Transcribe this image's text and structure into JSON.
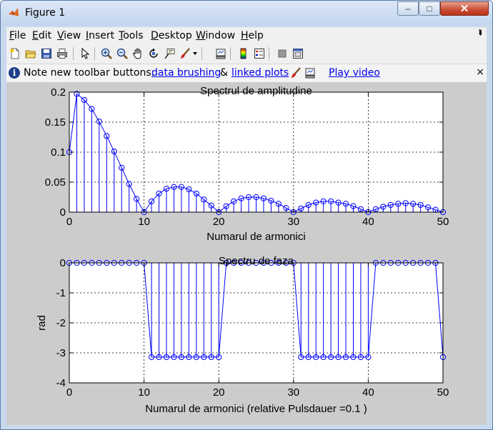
{
  "window": {
    "title": "Figure 1",
    "controls": {
      "minimize": "–",
      "maximize": "□",
      "close": "✕"
    }
  },
  "menu": {
    "items": [
      "File",
      "Edit",
      "View",
      "Insert",
      "Tools",
      "Desktop",
      "Window",
      "Help"
    ],
    "overflow_icon": "chevron-icon"
  },
  "toolbar": {
    "buttons": [
      "new-figure-icon",
      "open-file-icon",
      "save-icon",
      "print-icon",
      "edit-plot-icon",
      "zoom-in-icon",
      "zoom-out-icon",
      "pan-icon",
      "rotate-3d-icon",
      "data-cursor-icon",
      "brush-icon",
      "brush-dropdown-icon",
      "link-plot-icon",
      "insert-colorbar-icon",
      "insert-legend-icon",
      "hide-plot-tools-icon",
      "show-plot-tools-icon"
    ]
  },
  "notification": {
    "text_before": "Note new toolbar buttons:",
    "link_brushing": "data brushing",
    "amp": "&",
    "link_linked": "linked plots",
    "link_video": "Play video",
    "close": "×"
  },
  "chart_data": [
    {
      "type": "stem",
      "title": "Spectrul de amplitudine",
      "xlabel": "Numarul de armonici",
      "ylabel": "",
      "xlim": [
        0,
        50
      ],
      "ylim": [
        0,
        0.2
      ],
      "xticks": [
        0,
        10,
        20,
        30,
        40,
        50
      ],
      "yticks": [
        0,
        0.05,
        0.1,
        0.15,
        0.2
      ],
      "ytick_labels": [
        "0",
        "0.05",
        "0.1",
        "0.15",
        "0.2"
      ],
      "grid": true,
      "color": "#0000ff",
      "marker": "circle",
      "connected_line": true,
      "x": [
        0,
        1,
        2,
        3,
        4,
        5,
        6,
        7,
        8,
        9,
        10,
        11,
        12,
        13,
        14,
        15,
        16,
        17,
        18,
        19,
        20,
        21,
        22,
        23,
        24,
        25,
        26,
        27,
        28,
        29,
        30,
        31,
        32,
        33,
        34,
        35,
        36,
        37,
        38,
        39,
        40,
        41,
        42,
        43,
        44,
        45,
        46,
        47,
        48,
        49,
        50
      ],
      "y": [
        0.1,
        0.197,
        0.187,
        0.172,
        0.151,
        0.127,
        0.101,
        0.074,
        0.047,
        0.022,
        0,
        0.018,
        0.031,
        0.039,
        0.042,
        0.042,
        0.038,
        0.031,
        0.021,
        0.011,
        0,
        0.01,
        0.018,
        0.023,
        0.025,
        0.025,
        0.023,
        0.019,
        0.014,
        0.007,
        0,
        0.006,
        0.012,
        0.016,
        0.018,
        0.018,
        0.016,
        0.014,
        0.01,
        0.005,
        0,
        0.005,
        0.009,
        0.012,
        0.014,
        0.015,
        0.014,
        0.012,
        0.008,
        0.004,
        0
      ]
    },
    {
      "type": "stem",
      "title": "Spectru de faza",
      "xlabel": "Numarul de armonici (relative Pulsdauer =0.1 )",
      "ylabel": "rad",
      "xlim": [
        0,
        50
      ],
      "ylim": [
        -4,
        0
      ],
      "xticks": [
        0,
        10,
        20,
        30,
        40,
        50
      ],
      "yticks": [
        -4,
        -3,
        -2,
        -1,
        0
      ],
      "ytick_labels": [
        "-4",
        "-3",
        "-2",
        "-1",
        "0"
      ],
      "grid": true,
      "color": "#0000ff",
      "marker": "circle",
      "connected_line": true,
      "x": [
        0,
        1,
        2,
        3,
        4,
        5,
        6,
        7,
        8,
        9,
        10,
        11,
        12,
        13,
        14,
        15,
        16,
        17,
        18,
        19,
        20,
        21,
        22,
        23,
        24,
        25,
        26,
        27,
        28,
        29,
        30,
        31,
        32,
        33,
        34,
        35,
        36,
        37,
        38,
        39,
        40,
        41,
        42,
        43,
        44,
        45,
        46,
        47,
        48,
        49,
        50
      ],
      "y": [
        0,
        0,
        0,
        0,
        0,
        0,
        0,
        0,
        0,
        0,
        0,
        -3.1416,
        -3.1416,
        -3.1416,
        -3.1416,
        -3.1416,
        -3.1416,
        -3.1416,
        -3.1416,
        -3.1416,
        -3.1416,
        0,
        0,
        0,
        0,
        0,
        0,
        0,
        0,
        0,
        0,
        -3.1416,
        -3.1416,
        -3.1416,
        -3.1416,
        -3.1416,
        -3.1416,
        -3.1416,
        -3.1416,
        -3.1416,
        -3.1416,
        0,
        0,
        0,
        0,
        0,
        0,
        0,
        0,
        0,
        -3.1416
      ]
    }
  ]
}
